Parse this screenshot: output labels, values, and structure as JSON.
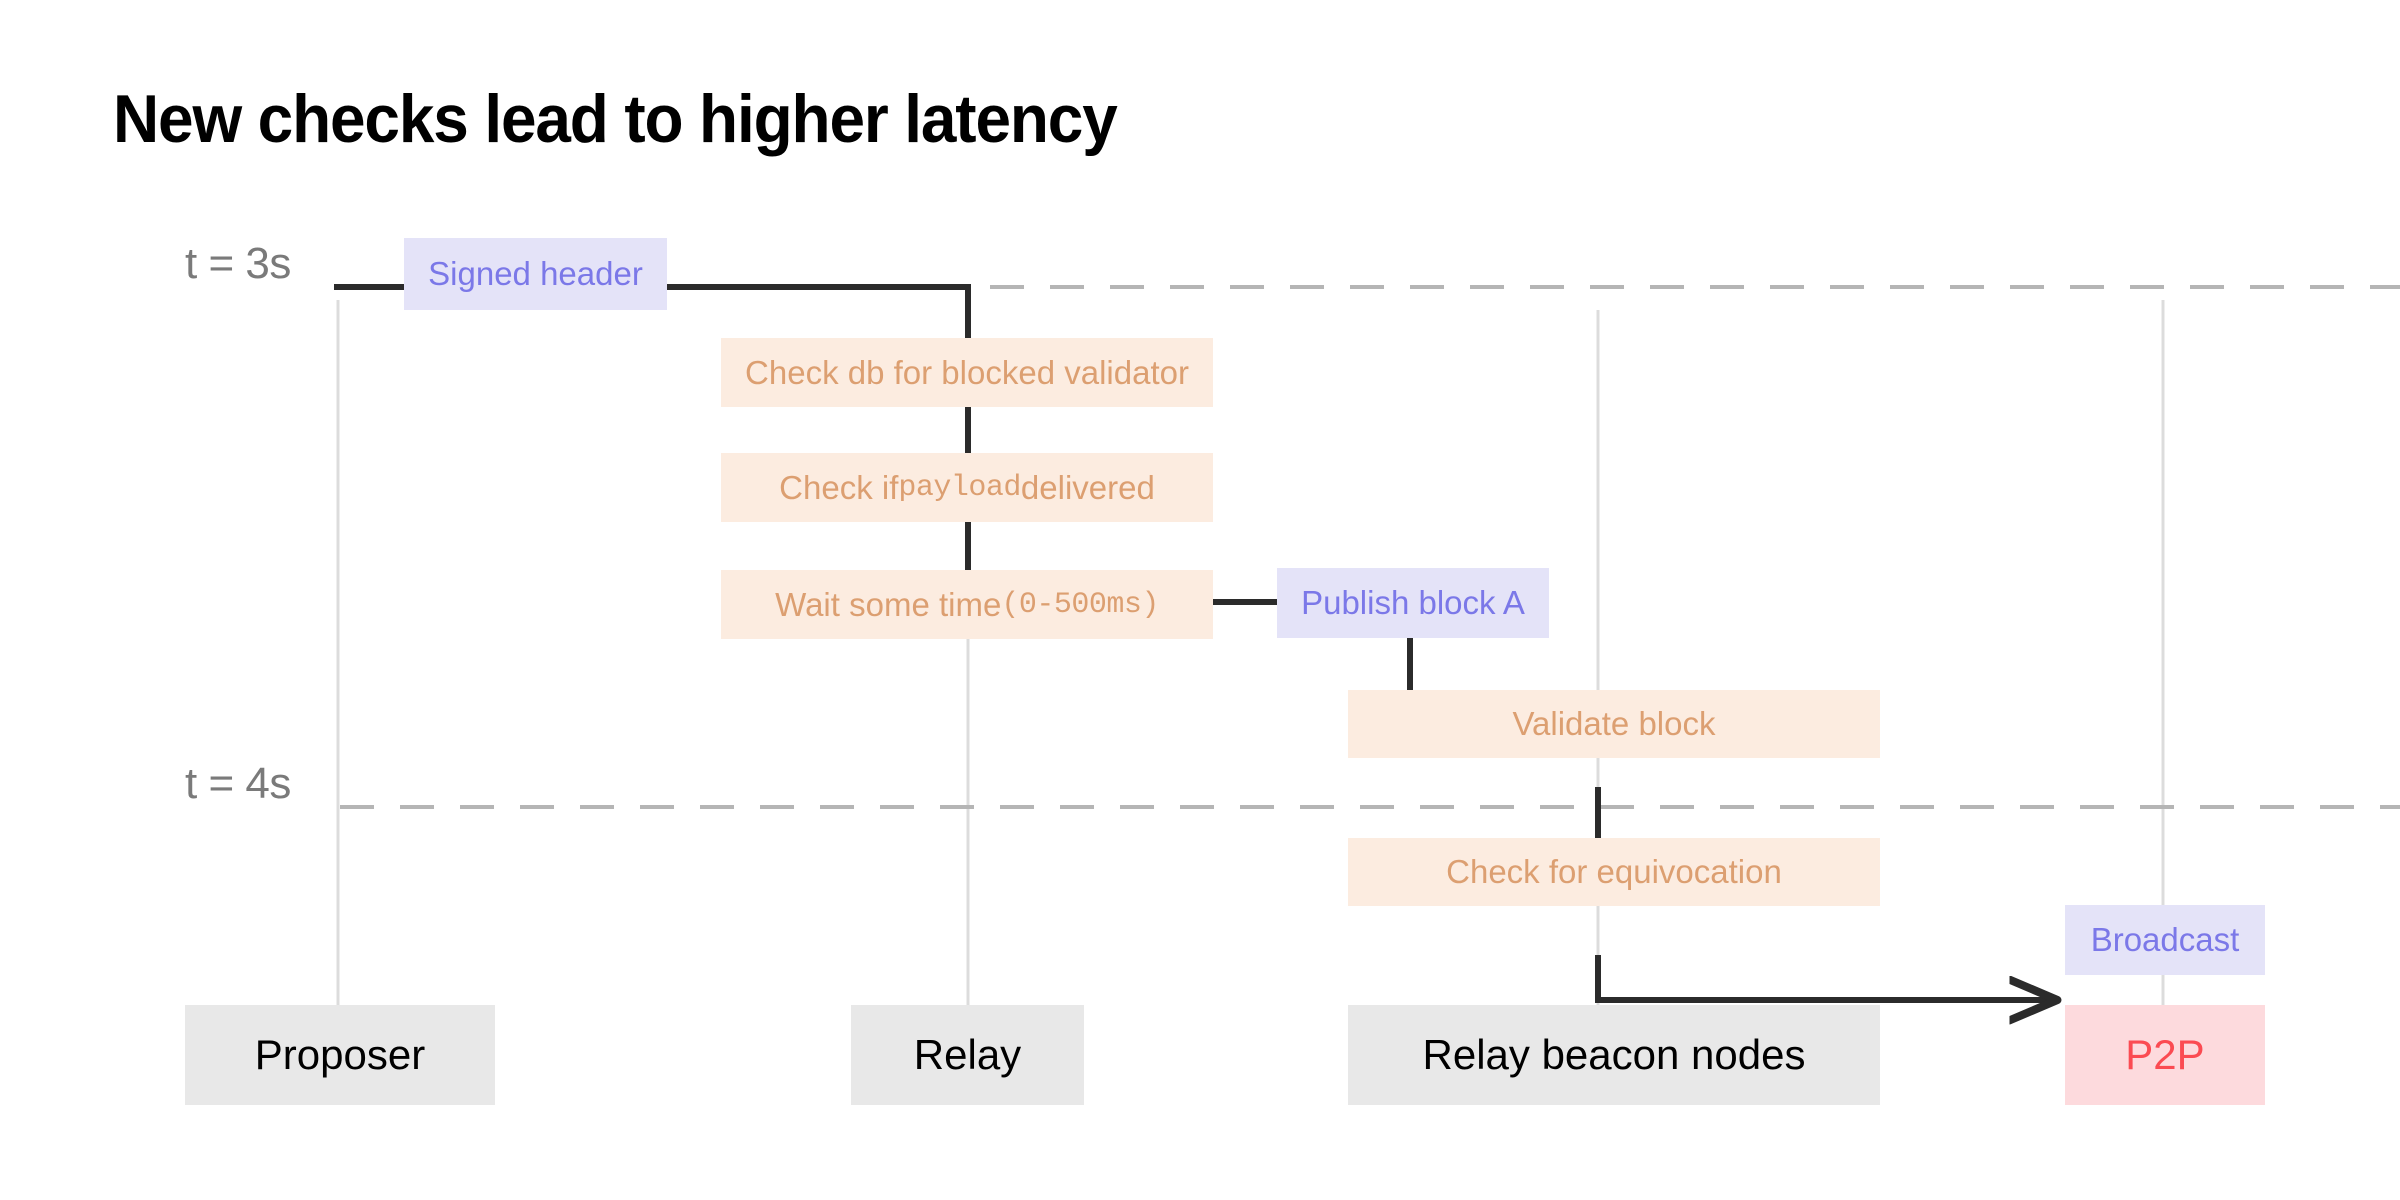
{
  "title": "New checks lead to higher latency",
  "colors": {
    "message_fill": "#e4e3f8",
    "message_text": "#7b78e8",
    "task_fill": "#fcece0",
    "task_text": "#dc9f71",
    "lane_fill": "#e8e8e8",
    "lane_text": "#000000",
    "p2p_fill": "#fddadd",
    "p2p_text": "#fb4b52",
    "connector": "#2b2b2b",
    "lane_line": "#dcdcdc",
    "time_dash": "#b5b5b5",
    "time_label": "#7a7a7a"
  },
  "time_markers": [
    {
      "id": "t3",
      "label": "t = 3s"
    },
    {
      "id": "t4",
      "label": "t = 4s"
    }
  ],
  "lanes": [
    {
      "id": "proposer",
      "label": "Proposer",
      "kind": "lane"
    },
    {
      "id": "relay",
      "label": "Relay",
      "kind": "lane"
    },
    {
      "id": "relay-beacon-nodes",
      "label": "Relay beacon nodes",
      "kind": "lane"
    },
    {
      "id": "p2p",
      "label": "P2P",
      "kind": "p2p"
    }
  ],
  "steps": [
    {
      "id": "signed-header",
      "kind": "message",
      "lane": "proposer",
      "label": "Signed header"
    },
    {
      "id": "check-db-blocked-validator",
      "kind": "task",
      "lane": "relay",
      "label": "Check db for blocked validator"
    },
    {
      "id": "check-payload-delivered",
      "kind": "task",
      "lane": "relay",
      "label_pre": "Check if ",
      "label_mono": "payload",
      "label_post": " delivered"
    },
    {
      "id": "wait-some-time",
      "kind": "task",
      "lane": "relay",
      "label_pre": "Wait some time ",
      "label_mono": "(0-500ms)",
      "label_post": ""
    },
    {
      "id": "publish-block-a",
      "kind": "message",
      "lane": "relay-beacon-nodes",
      "label": "Publish block A"
    },
    {
      "id": "validate-block",
      "kind": "task",
      "lane": "relay-beacon-nodes",
      "label": "Validate block"
    },
    {
      "id": "check-for-equivocation",
      "kind": "task",
      "lane": "relay-beacon-nodes",
      "label": "Check for equivocation"
    },
    {
      "id": "broadcast",
      "kind": "message",
      "lane": "p2p",
      "label": "Broadcast"
    }
  ]
}
